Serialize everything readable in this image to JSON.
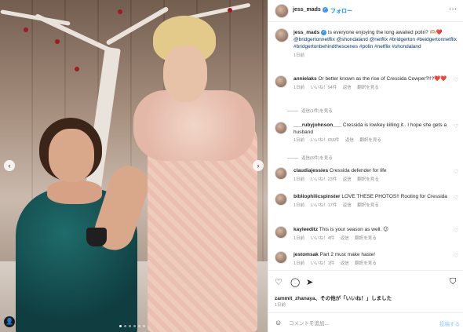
{
  "post": {
    "username": "jess_mads",
    "follow_label": "フォロー",
    "more_icon": "more-horizontal-icon",
    "caption_text": "Is everyone enjoying the long awaited polin? 🫶🏼❤️",
    "caption_tags": "@bridgertonnetflix @shondaland @netflix #bridgerton #beidgertonnetflix #bridgertonbehindthescenes #polin #netflix #shondaland",
    "caption_time": "1日前"
  },
  "comments": [
    {
      "user": "annielaks",
      "text": "Or better known as the rise of Cressida Cowper?!!?❤️❤️",
      "time": "1日前",
      "likes": "いいね！94件",
      "reply": "返信",
      "translate": "翻訳を見る",
      "replies": "返信(1件)を見る"
    },
    {
      "user": "___rubyjohnson___",
      "text": "Cressida is lowkey killing it.. I hope she gets a husband",
      "time": "1日前",
      "likes": "いいね！656件",
      "reply": "返信",
      "translate": "翻訳を見る",
      "replies": "返信(6件)を見る"
    },
    {
      "user": "claudiajessies",
      "text": "Cressida defender for life",
      "time": "1日前",
      "likes": "いいね！23件",
      "reply": "返信",
      "translate": "翻訳を見る",
      "replies": ""
    },
    {
      "user": "bibliophilicspinster",
      "text": "LOVE THESE PHOTOS!! Rooting for Cressida",
      "time": "1日前",
      "likes": "いいね！17件",
      "reply": "返信",
      "translate": "翻訳を見る",
      "replies": ""
    },
    {
      "user": "kayleeditz",
      "text": "This is your season as well. 😉",
      "time": "1日前",
      "likes": "いいね！4件",
      "reply": "返信",
      "translate": "翻訳を見る",
      "replies": ""
    },
    {
      "user": "jestomsak",
      "text": "Part 2 must make haste!",
      "time": "1日前",
      "likes": "いいね！1件",
      "reply": "返信",
      "translate": "翻訳を見る",
      "replies": ""
    }
  ],
  "liked_by": {
    "user": "zammit_zhanaya",
    "text": "、その他が「いいね！」しました"
  },
  "post_time": "1日前",
  "add_comment": {
    "placeholder": "コメントを追加...",
    "post_label": "投稿する"
  },
  "colors": {
    "link": "#00376b",
    "follow": "#0095f6",
    "verified": "#3897f0",
    "muted": "#8e8e8e"
  },
  "carousel": {
    "current": 1,
    "total": 6
  }
}
